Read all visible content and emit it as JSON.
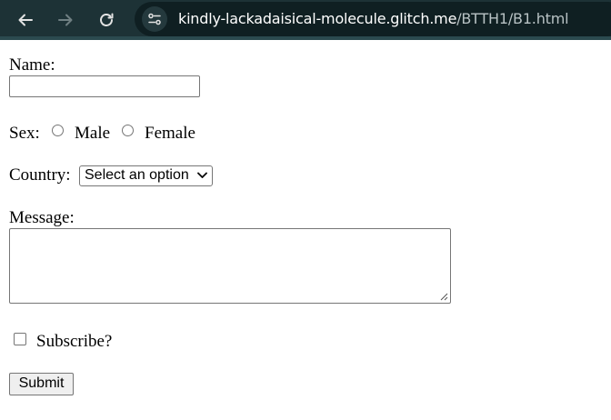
{
  "browser": {
    "url_host": "kindly-lackadaisical-molecule.glitch.me",
    "url_path": "/BTTH1/B1.html",
    "icons": [
      "back-arrow-icon",
      "forward-arrow-icon",
      "reload-icon",
      "site-settings-icon"
    ]
  },
  "form": {
    "name_label": "Name:",
    "name_value": "",
    "sex_label": "Sex:",
    "sex_options": [
      "Male",
      "Female"
    ],
    "country_label": "Country:",
    "country_selected": "Select an option",
    "message_label": "Message:",
    "message_value": "",
    "subscribe_label": "Subscribe?",
    "submit_label": "Submit"
  }
}
